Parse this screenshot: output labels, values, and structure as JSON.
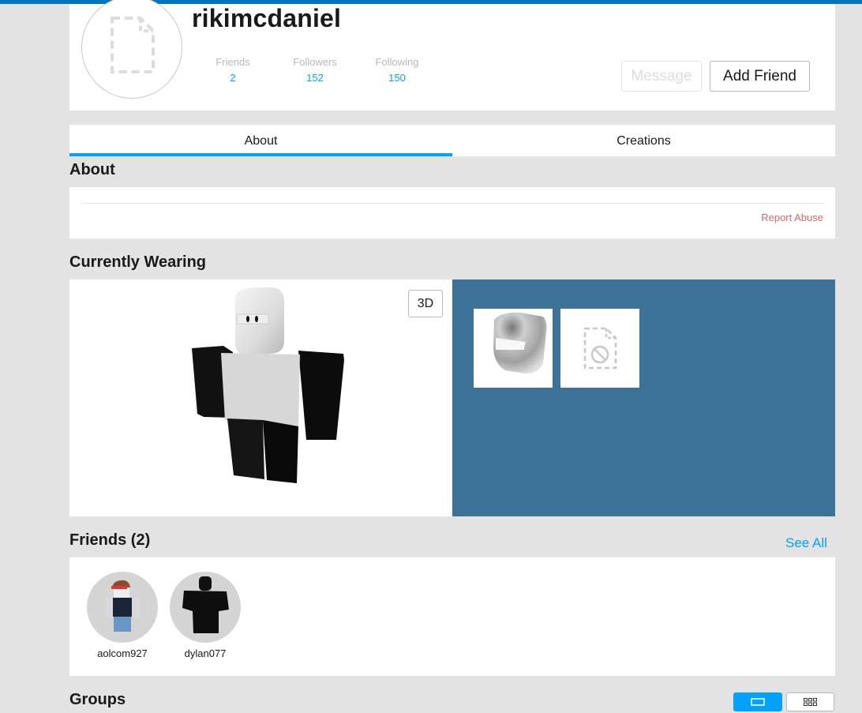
{
  "profile": {
    "username": "rikimcdaniel",
    "avatar_icon": "placeholder-file-icon",
    "stats": [
      {
        "label": "Friends",
        "value": "2"
      },
      {
        "label": "Followers",
        "value": "152"
      },
      {
        "label": "Following",
        "value": "150"
      }
    ],
    "buttons": {
      "message": "Message",
      "add_friend": "Add Friend"
    }
  },
  "tabs": [
    {
      "label": "About",
      "active": true
    },
    {
      "label": "Creations",
      "active": false
    }
  ],
  "about": {
    "title": "About",
    "report_abuse": "Report Abuse"
  },
  "wearing": {
    "title": "Currently Wearing",
    "toggle_3d": "3D",
    "items": [
      {
        "name": "white-helmet-item"
      },
      {
        "name": "unavailable-item"
      }
    ]
  },
  "friends": {
    "title": "Friends (2)",
    "see_all": "See All",
    "list": [
      {
        "name": "aolcom927"
      },
      {
        "name": "dylan077"
      }
    ]
  },
  "groups": {
    "title": "Groups",
    "view_modes": [
      "slideshow",
      "grid"
    ],
    "active_view": "slideshow"
  },
  "colors": {
    "accent": "#00a2ff",
    "topbar": "#0074bd",
    "wearing_bg": "#3d7399",
    "report": "#d86868"
  }
}
